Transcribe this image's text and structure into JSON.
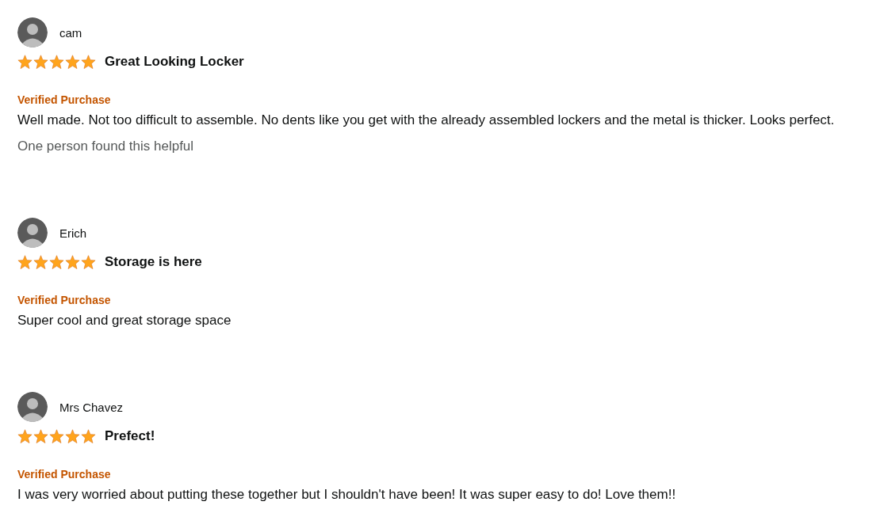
{
  "reviews": [
    {
      "reviewer": "cam",
      "stars": 5,
      "title": "Great Looking Locker",
      "badge": "Verified Purchase",
      "body": "Well made. Not too difficult to assemble. No dents like you get with the already assembled lockers and the metal is thicker. Looks perfect.",
      "helpful": "One person found this helpful"
    },
    {
      "reviewer": "Erich",
      "stars": 5,
      "title": "Storage is here",
      "badge": "Verified Purchase",
      "body": "Super cool and great storage space"
    },
    {
      "reviewer": "Mrs Chavez",
      "stars": 5,
      "title": "Prefect!",
      "badge": "Verified Purchase",
      "body": "I was very worried about putting these together but I shouldn't have been! It was super easy to do! Love them!!"
    }
  ]
}
